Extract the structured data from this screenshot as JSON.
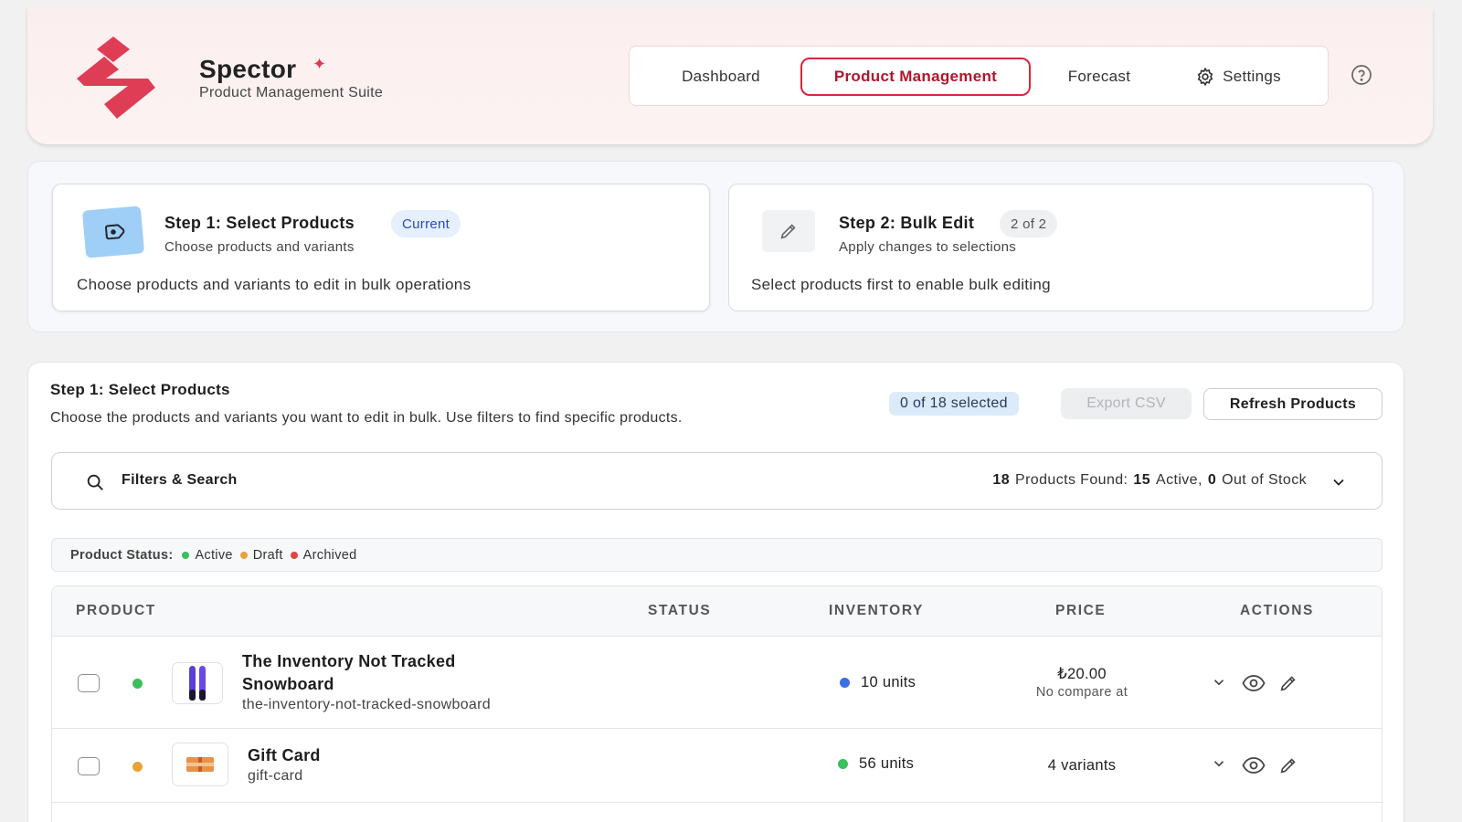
{
  "header": {
    "brand": "Spector",
    "brand_mark": "✦",
    "subtitle": "Product Management Suite",
    "nav": {
      "dashboard": "Dashboard",
      "product_management": "Product Management",
      "forecast": "Forecast",
      "settings": "Settings"
    },
    "accent_color": "#d9263e"
  },
  "steps": {
    "step1": {
      "title": "Step 1: Select Products",
      "badge": "Current",
      "subtitle": "Choose products and variants",
      "description": "Choose products and variants to edit in bulk operations",
      "icon": "tag-icon"
    },
    "step2": {
      "title": "Step 2: Bulk Edit",
      "badge": "2 of 2",
      "subtitle": "Apply changes to selections",
      "description": "Select products first to enable bulk editing",
      "icon": "pencil-icon"
    }
  },
  "main": {
    "title": "Step 1: Select Products",
    "description": "Choose the products and variants you want to edit in bulk. Use filters to find specific products.",
    "selected_badge": "0 of 18 selected",
    "export_label": "Export CSV",
    "refresh_label": "Refresh Products",
    "filters": {
      "label": "Filters & Search",
      "products_count": "18",
      "products_label": "Products Found:",
      "active_count": "15",
      "active_label": "Active,",
      "out_count": "0",
      "out_label": "Out of Stock"
    },
    "legend": {
      "label": "Product Status:",
      "active": "Active",
      "draft": "Draft",
      "archived": "Archived",
      "colors": {
        "active": "#3cbf5c",
        "draft": "#e8a23a",
        "archived": "#e0453e"
      }
    },
    "table": {
      "columns": [
        "PRODUCT",
        "STATUS",
        "INVENTORY",
        "PRICE",
        "ACTIONS"
      ],
      "rows": [
        {
          "name": "The Inventory Not Tracked Snowboard",
          "handle": "the-inventory-not-tracked-snowboard",
          "status": "active",
          "inventory": "10 units",
          "inventory_color": "#3b6fe0",
          "price": "₺20.00",
          "price_sub": "No compare at"
        },
        {
          "name": "Gift Card",
          "handle": "gift-card",
          "status": "draft",
          "inventory": "56 units",
          "inventory_color": "#3cbf5c",
          "price": "4 variants",
          "price_sub": ""
        }
      ]
    }
  }
}
